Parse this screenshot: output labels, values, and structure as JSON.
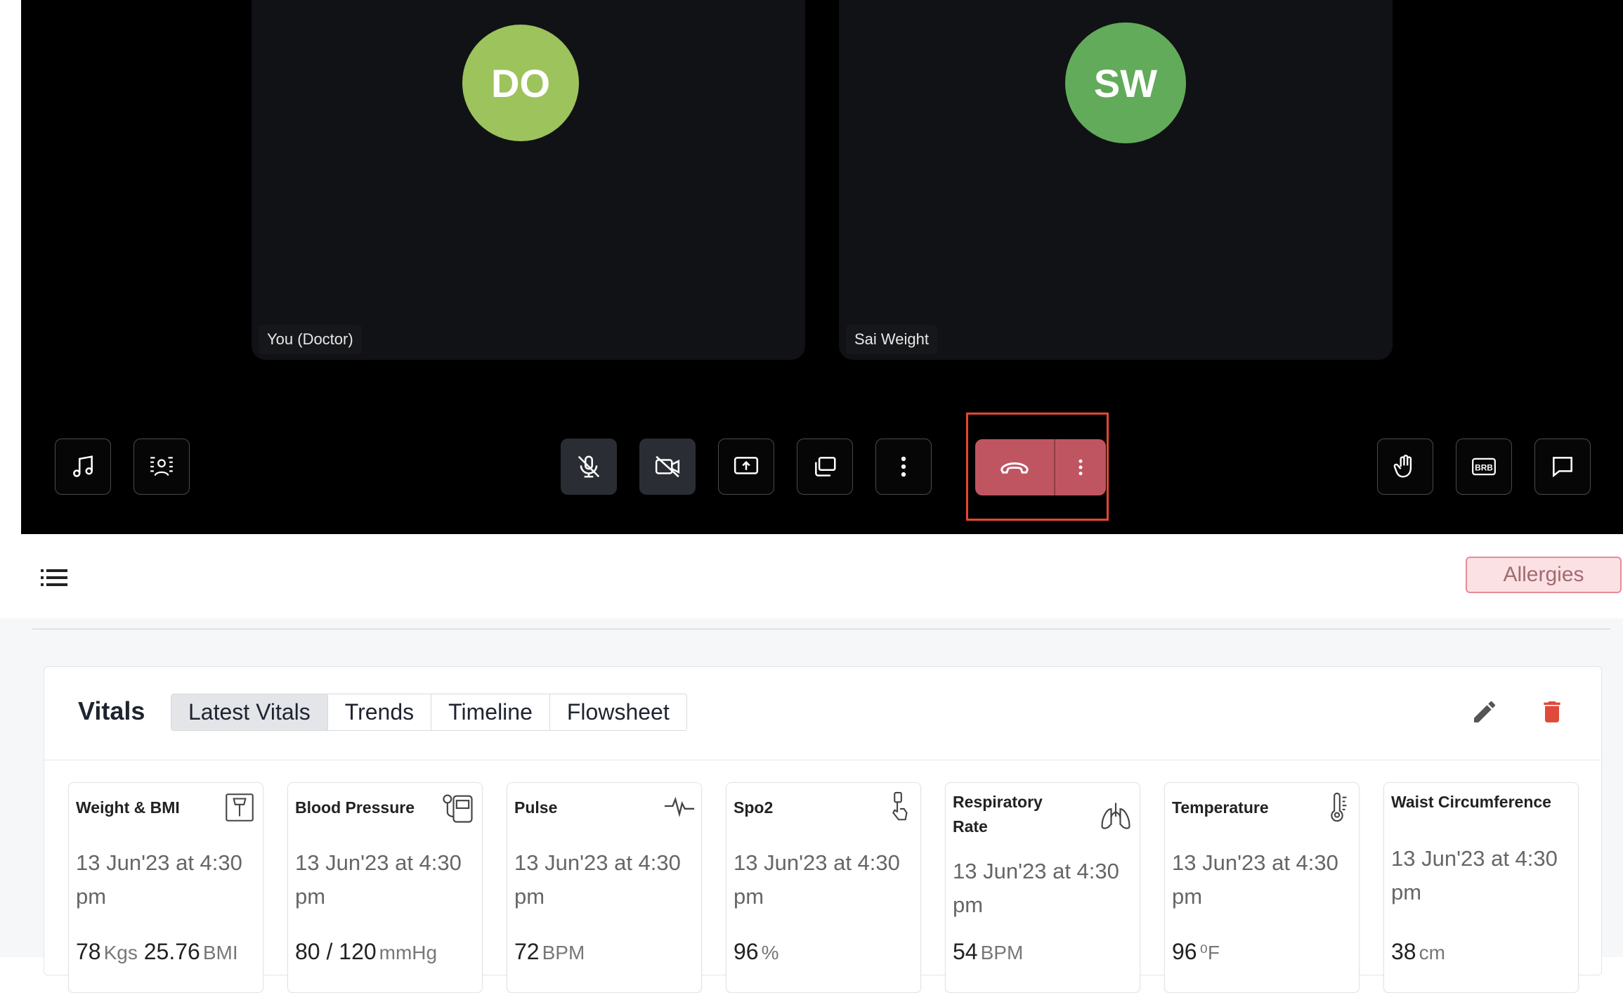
{
  "call": {
    "participants": [
      {
        "initials": "DO",
        "name": "You (Doctor)",
        "color": "#9cc35c"
      },
      {
        "initials": "SW",
        "name": "Sai Weight",
        "color": "#62ab5a"
      }
    ],
    "controls_left": [
      "music-note-icon",
      "background-blur-icon"
    ],
    "controls_center": [
      "microphone-off-icon",
      "camera-off-icon",
      "share-screen-icon",
      "picture-in-picture-icon",
      "more-vertical-icon"
    ],
    "end_call": {
      "icon": "phone-hangup-icon",
      "color": "#c05562"
    },
    "controls_right": [
      "raise-hand-icon",
      "brb-icon",
      "chat-icon"
    ],
    "brb_label": "BRB"
  },
  "toolbar": {
    "allergies_label": "Allergies"
  },
  "vitals": {
    "title": "Vitals",
    "tabs": [
      {
        "label": "Latest Vitals",
        "active": true
      },
      {
        "label": "Trends",
        "active": false
      },
      {
        "label": "Timeline",
        "active": false
      },
      {
        "label": "Flowsheet",
        "active": false
      }
    ],
    "cards": [
      {
        "title": "Weight & BMI",
        "icon": "scale-icon",
        "date": "13 Jun'23 at 4:30 pm",
        "value": "78",
        "unit": "Kgs",
        "value2": "25.76",
        "unit2": "BMI"
      },
      {
        "title": "Blood Pressure",
        "icon": "blood-pressure-monitor-icon",
        "date": "13 Jun'23 at 4:30 pm",
        "value": "80 / 120",
        "unit": "mmHg"
      },
      {
        "title": "Pulse",
        "icon": "pulse-wave-icon",
        "date": "13 Jun'23 at 4:30 pm",
        "value": "72",
        "unit": "BPM"
      },
      {
        "title": "Spo2",
        "icon": "finger-oximeter-icon",
        "date": "13 Jun'23 at 4:30 pm",
        "value": "96",
        "unit": "%"
      },
      {
        "title": "Respiratory Rate",
        "icon": "lungs-icon",
        "date": "13 Jun'23 at 4:30 pm",
        "value": "54",
        "unit": "BPM"
      },
      {
        "title": "Temperature",
        "icon": "thermometer-icon",
        "date": "13 Jun'23 at 4:30 pm",
        "value": "96",
        "unit": "⁰F"
      },
      {
        "title": "Waist Circumference",
        "icon": "",
        "date": "13 Jun'23 at 4:30 pm",
        "value": "38",
        "unit": "cm"
      }
    ]
  },
  "colors": {
    "call_bg": "#000000",
    "tile_bg": "#111215",
    "highlight": "#e5462f",
    "delete": "#e04a3a",
    "allergies_bg": "#fbe1e4"
  }
}
